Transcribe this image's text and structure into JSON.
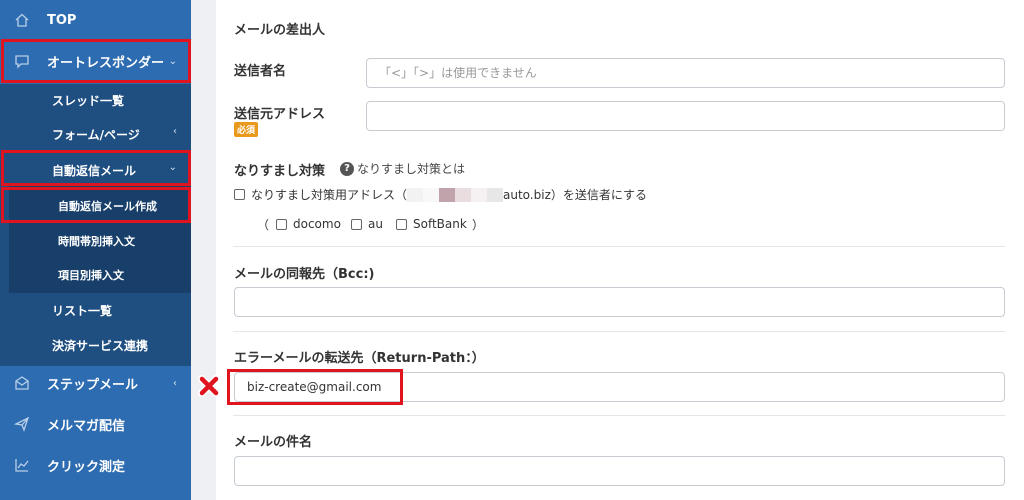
{
  "sidebar": {
    "top": "TOP",
    "autoresponder": "オートレスポンダー",
    "thread_list": "スレッド一覧",
    "form_page": "フォーム/ページ",
    "auto_reply": "自動返信メール",
    "auto_reply_create": "自動返信メール作成",
    "time_insert": "時間帯別挿入文",
    "item_insert": "項目別挿入文",
    "list": "リスト一覧",
    "payment": "決済サービス連携",
    "step_mail": "ステップメール",
    "mail_magazine": "メルマガ配信",
    "click_measure": "クリック測定"
  },
  "form": {
    "sender_section": "メールの差出人",
    "sender_name_label": "送信者名",
    "sender_name_placeholder": "「<」「>」は使用できません",
    "sender_address_label": "送信元アドレス",
    "required_badge": "必須",
    "spoof_label": "なりすまし対策",
    "spoof_help": "なりすまし対策とは",
    "spoof_checkbox_prefix": "なりすまし対策用アドレス（",
    "spoof_checkbox_domain": "auto.biz）を送信者にする",
    "paren_open": "（",
    "paren_close": "）",
    "carrier_docomo": "docomo",
    "carrier_au": "au",
    "carrier_softbank": "SoftBank",
    "bcc_label": "メールの同報先（Bcc:)",
    "return_path_label": "エラーメールの転送先（Return-Path：）",
    "return_path_value": "biz-create@gmail.com",
    "subject_label": "メールの件名"
  },
  "colors": {
    "sidebar": "#2d6cb0",
    "sub_nav": "#1f4e80",
    "highlight": "#e0141e",
    "badge": "#e99a1d"
  }
}
